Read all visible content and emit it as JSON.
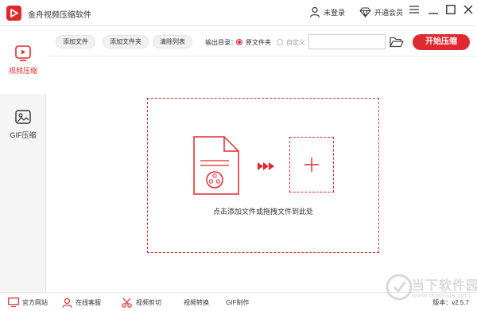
{
  "app": {
    "title": "金舟视频压缩软件",
    "accent": "#e0292f"
  },
  "titlebar": {
    "login_label": "未登录",
    "vip_label": "开通会员",
    "menu_icon": "menu-icon",
    "minimize_icon": "minimize-icon",
    "maximize_icon": "maximize-icon",
    "close_icon": "close-icon"
  },
  "sidebar": {
    "items": [
      {
        "label": "视频压缩",
        "icon": "video-play-icon",
        "active": true
      },
      {
        "label": "GIF压缩",
        "icon": "gif-image-icon",
        "active": false
      }
    ]
  },
  "toolbar": {
    "add_file": "添加文件",
    "add_folder": "添加文件夹",
    "clear_list": "清除列表",
    "output_label": "输出目录：",
    "option_source": "原文件夹",
    "option_custom": "自定义",
    "selected_option": "原文件夹",
    "path_value": "",
    "start_label": "开始压缩"
  },
  "dropzone": {
    "hint": "点击添加文件或拖拽文件到此处"
  },
  "footer": {
    "website": "官方网站",
    "support": "在线客服",
    "video_cut": "视频剪切",
    "video_convert": "视频转换",
    "gif_make": "GIF制作",
    "version": "版本：v2.5.7"
  },
  "watermark": {
    "name": "当下软件园",
    "url": "www.downxia.com"
  }
}
